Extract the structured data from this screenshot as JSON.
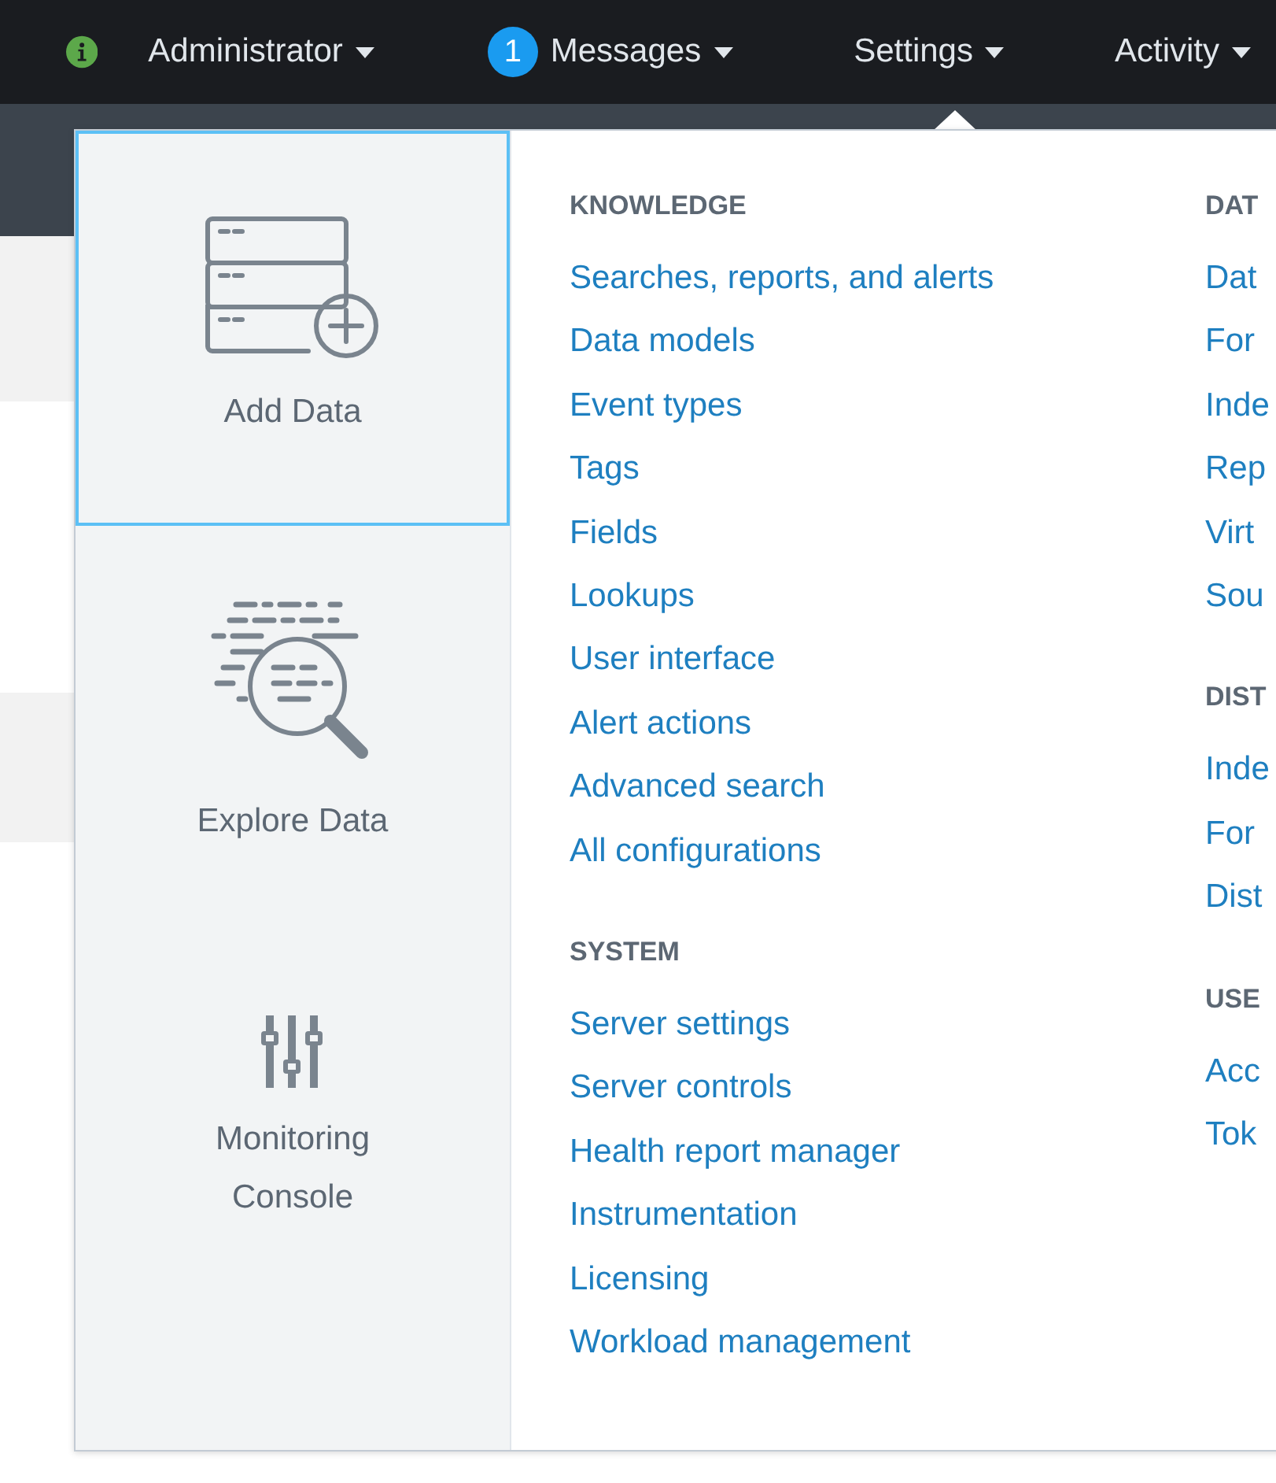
{
  "nav": [
    {
      "kind": "status",
      "label": "Administrator"
    },
    {
      "kind": "badge",
      "badge": "1",
      "label": "Messages"
    },
    {
      "kind": "plain",
      "label": "Settings"
    },
    {
      "kind": "plain",
      "label": "Activity"
    }
  ],
  "shortcuts": [
    {
      "kind": "add",
      "label": "Add Data",
      "selected": true
    },
    {
      "kind": "explore",
      "label": "Explore Data",
      "selected": false
    },
    {
      "kind": "monitor",
      "label": "Monitoring Console",
      "selected": false
    }
  ],
  "columns": [
    {
      "sections": [
        {
          "heading": "KNOWLEDGE",
          "links": [
            "Searches, reports, and alerts",
            "Data models",
            "Event types",
            "Tags",
            "Fields",
            "Lookups",
            "User interface",
            "Alert actions",
            "Advanced search",
            "All configurations"
          ]
        },
        {
          "heading": "SYSTEM",
          "links": [
            "Server settings",
            "Server controls",
            "Health report manager",
            "Instrumentation",
            "Licensing",
            "Workload management"
          ]
        }
      ]
    },
    {
      "sections": [
        {
          "heading": "DAT",
          "links": [
            "Dat",
            "For",
            "Inde",
            "Rep",
            "Virt",
            "Sou"
          ]
        },
        {
          "heading": "DIST",
          "links": [
            "Inde",
            "For",
            "Dist"
          ]
        },
        {
          "heading": "USE",
          "links": [
            "Acc",
            "Tok"
          ]
        }
      ]
    }
  ]
}
